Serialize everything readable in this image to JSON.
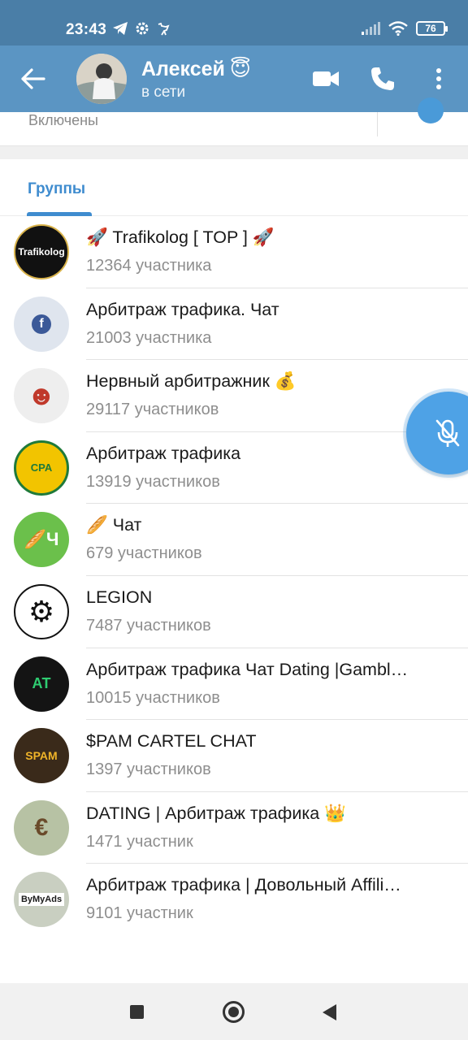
{
  "status_bar": {
    "time": "23:43",
    "battery": "76",
    "icons": [
      "telegram-icon",
      "gear-icon",
      "ostrich-icon",
      "signal-icon",
      "wifi-icon",
      "battery-icon"
    ]
  },
  "header": {
    "name": "Алексей",
    "emoji": "😇",
    "status": "в сети",
    "colors": {
      "bar": "#5b95c3",
      "status_bar": "#4a7ea7"
    }
  },
  "info_strip": {
    "label": "Включены"
  },
  "tabs": [
    {
      "label": "Группы",
      "active": true
    }
  ],
  "groups": [
    {
      "title": "🚀 Trafikolog [ TOP ] 🚀",
      "subtitle": "12364 участника",
      "avatar_bg": "#111111",
      "avatar_text": "Trafikolog",
      "avatar_fg": "#ffffff"
    },
    {
      "title": "Арбитраж трафика. Чат",
      "subtitle": "21003 участника",
      "avatar_bg": "#dfe5ee",
      "avatar_text": "f",
      "avatar_fg": "#3b5998"
    },
    {
      "title": "Нервный арбитражник 💰",
      "subtitle": "29117 участников",
      "avatar_bg": "#eeeeee",
      "avatar_text": "☻",
      "avatar_fg": "#c0392b"
    },
    {
      "title": "Арбитраж трафика",
      "subtitle": "13919 участников",
      "avatar_bg": "#f2c400",
      "avatar_text": "CPA",
      "avatar_fg": "#1f7a3a"
    },
    {
      "title": "🥖 Чат",
      "subtitle": "679 участников",
      "avatar_bg": "#6bc04b",
      "avatar_text": "🥖Ч",
      "avatar_fg": "#ffffff"
    },
    {
      "title": "LEGION",
      "subtitle": "7487 участников",
      "avatar_bg": "#ffffff",
      "avatar_text": "⚙",
      "avatar_fg": "#111111"
    },
    {
      "title": "Арбитраж трафика Чат Dating |Gambl…",
      "subtitle": "10015 участников",
      "avatar_bg": "#141414",
      "avatar_text": "АТ",
      "avatar_fg": "#2ecc71"
    },
    {
      "title": "$PAM CARTEL CHAT",
      "subtitle": "1397 участников",
      "avatar_bg": "#3a2a1a",
      "avatar_text": "SPAM",
      "avatar_fg": "#f0b429"
    },
    {
      "title": "DATING | Арбитраж трафика 👑",
      "subtitle": "1471 участник",
      "avatar_bg": "#b7c2a4",
      "avatar_text": "€",
      "avatar_fg": "#6a4a2a"
    },
    {
      "title": "Арбитраж трафика | Довольный Affili…",
      "subtitle": "9101 участник",
      "avatar_bg": "#c9cfc1",
      "avatar_text": "ByMyAds",
      "avatar_fg": "#1a1a1a"
    }
  ]
}
